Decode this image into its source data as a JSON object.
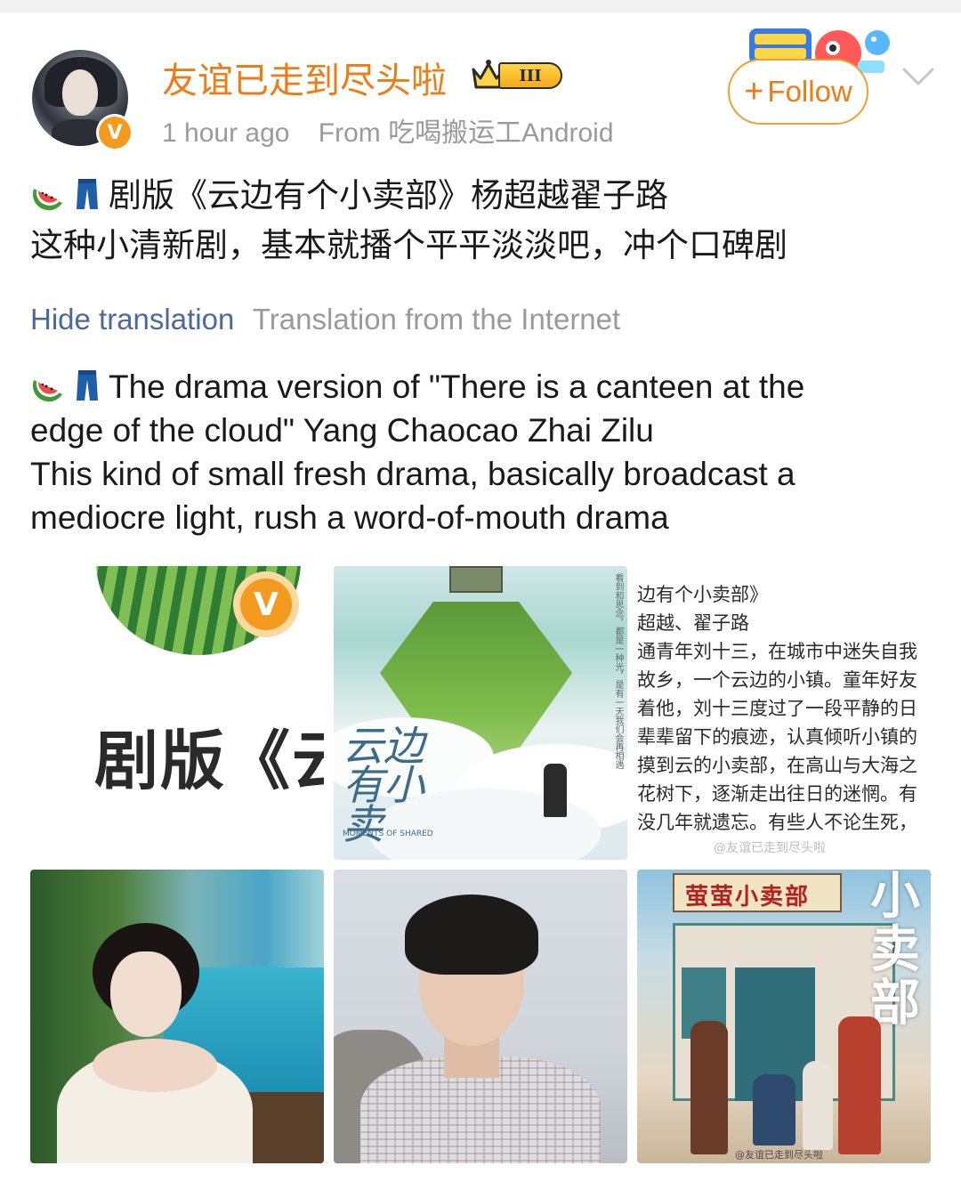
{
  "header": {
    "username": "友谊已走到尽头啦",
    "vip_level": "III",
    "time": "1 hour ago",
    "source": "From 吃喝搬运工Android",
    "follow_label": "Follow"
  },
  "post": {
    "zh_line1": "剧版《云边有个小卖部》杨超越翟子路",
    "zh_line2": "这种小清新剧，基本就播个平平淡淡吧，冲个口碑剧",
    "hide_translation": "Hide translation",
    "translation_source": "Translation from the Internet",
    "en_line1": "The drama version of \"There is a canteen at the",
    "en_line2": "edge of the cloud\" Yang Chaocao Zhai Zilu",
    "en_line3": "This kind of small fresh drama, basically broadcast a",
    "en_line4": "mediocre light, rush a word-of-mouth drama"
  },
  "images": {
    "img1_text": "剧版《云",
    "img2_title": "云边有小卖",
    "img2_en": "MOMENTS OF SHARED",
    "img2_vertical": "看到和思念，都是一种光，是有一天我们会再相遇",
    "img3_lines": [
      "边有个小卖部》",
      "超越、翟子路",
      "通青年刘十三，在城市中迷失自我",
      "故乡，一个云边的小镇。童年好友",
      "着他，刘十三度过了一段平静的日",
      "辈辈留下的痕迹，认真倾听小镇的",
      "摸到云的小卖部，在高山与大海之",
      "花树下，逐渐走出往日的迷惘。有",
      "没几年就遗忘。有些人不论生死，"
    ],
    "img3_watermark": "@友谊已走到尽头啦",
    "img6_sign": "萤萤小卖部",
    "img6_title": "小卖部",
    "img6_watermark": "@友谊已走到尽头啦"
  },
  "colors": {
    "username": "#f07a14",
    "link": "#4b6a9b",
    "muted": "#9a9a9a",
    "follow_border": "#f0a030"
  },
  "icons": [
    "avatar",
    "verified-v-icon",
    "vip-crown-icon",
    "festival-sticker",
    "chevron-down-icon",
    "watermelon-emoji",
    "jeans-emoji"
  ]
}
